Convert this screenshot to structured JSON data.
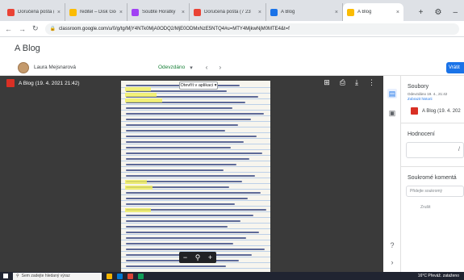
{
  "browser": {
    "tabs": [
      {
        "title": "Doručená pošta (1 54",
        "icon": "gmail-icon",
        "color": "#ea4335",
        "active": false
      },
      {
        "title": "ředitel – Disk Google",
        "icon": "drive-icon",
        "color": "#fbbc04",
        "active": false
      },
      {
        "title": "Soubté Horatky",
        "icon": "forms-icon",
        "color": "#a142f4",
        "active": false
      },
      {
        "title": "Doručená pošta (7 23",
        "icon": "gmail-icon",
        "color": "#ea4335",
        "active": false
      },
      {
        "title": "A Blog",
        "icon": "classroom-icon",
        "color": "#1a73e8",
        "active": false
      },
      {
        "title": "A Blog",
        "icon": "classroom-yellow-icon",
        "color": "#fbbc04",
        "active": true
      }
    ],
    "new_tab": "+",
    "url": "classroom.google.com/u/0/g/tg/MjY4NTk0MjA0ODQ2/MjE0ODMxNzE5NTQ4#u=MTY4MjkwNjM0MTE4&t=f"
  },
  "classroom": {
    "class_title": "A Blog",
    "student_name": "Laura Mejsnarová",
    "status": "Odevzdáno",
    "return_button": "Vrátit"
  },
  "viewer": {
    "file_title": "A Blog (19. 4. 2021 21:42)",
    "open_with": "Otevřít v aplikaci"
  },
  "side_panel": {
    "files_heading": "Soubory",
    "submitted_time": "Odevzdáno 19. 4., 21:42",
    "history_link": "Zobrazit historii",
    "file_name": "A Blog (19. 4. 202",
    "grade_heading": "Hodnocení",
    "grade_slash": "/",
    "private_comments_heading": "Soukromé komentá",
    "comment_placeholder": "Přidejte soukromý",
    "cancel_label": "Zrušit"
  },
  "taskbar": {
    "search_placeholder": "Sem zadejte hledaný výraz",
    "weather": "16°C Převáž. zataženo"
  }
}
